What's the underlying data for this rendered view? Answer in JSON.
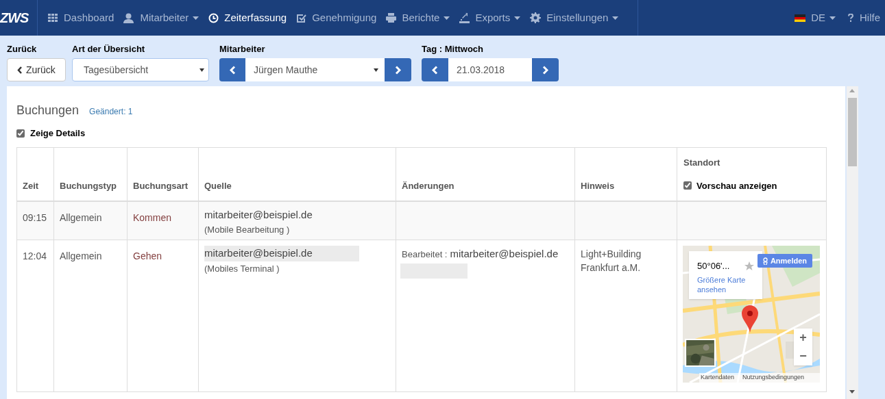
{
  "navbar": {
    "logo": "ZWS",
    "items": [
      {
        "label": "Dashboard",
        "kind": "grid",
        "dropdown": false,
        "selected": false
      },
      {
        "label": "Mitarbeiter",
        "kind": "user",
        "dropdown": true,
        "selected": false
      },
      {
        "label": "Zeiterfassung",
        "kind": "clock",
        "dropdown": false,
        "selected": true
      },
      {
        "label": "Genehmigung",
        "kind": "check",
        "dropdown": false,
        "selected": false
      },
      {
        "label": "Berichte",
        "kind": "printer",
        "dropdown": true,
        "selected": false
      },
      {
        "label": "Exports",
        "kind": "export",
        "dropdown": true,
        "selected": false
      },
      {
        "label": "Einstellungen",
        "kind": "gear",
        "dropdown": true,
        "selected": false
      }
    ],
    "language": {
      "label": "DE",
      "dropdown": true
    },
    "help": {
      "label": "Hilfe"
    }
  },
  "toolbar": {
    "back": {
      "label": "Zurück",
      "button": "Zurück"
    },
    "overview": {
      "label": "Art der Übersicht",
      "value": "Tagesübersicht"
    },
    "employee": {
      "label": "Mitarbeiter",
      "value": "Jürgen Mauthe"
    },
    "day": {
      "label": "Tag : Mittwoch",
      "value": "21.03.2018"
    }
  },
  "bookings": {
    "title": "Buchungen",
    "changed": "Geändert: 1",
    "show_details": {
      "label": "Zeige Details",
      "checked": true
    },
    "columns": [
      "Zeit",
      "Buchungstyp",
      "Buchungsart",
      "Quelle",
      "Änderungen",
      "Hinweis",
      "Standort"
    ],
    "preview": {
      "label": "Vorschau anzeigen",
      "checked": true
    },
    "rows": [
      {
        "time": "09:15",
        "type": "Allgemein",
        "kind": "Kommen",
        "source": "mitarbeiter@beispiel.de",
        "device": "(Mobile Bearbeitung )",
        "highlighted": false
      },
      {
        "time": "12:04",
        "type": "Allgemein",
        "kind": "Gehen",
        "source": "mitarbeiter@beispiel.de",
        "device": "(Mobiles Terminal )",
        "highlighted": true,
        "changes": {
          "label": "Bearbeitet :",
          "by": "mitarbeiter@beispiel.de"
        },
        "note": [
          "Light+Building",
          "Frankfurt a.M."
        ],
        "map": {
          "coords": "50°06'...",
          "link": "Größere Karte ansehen",
          "signin": "Anmelden",
          "zoom_in": "+",
          "zoom_out": "−",
          "footer": [
            "Kartendaten",
            "Nutzungsbedingungen"
          ]
        }
      }
    ]
  }
}
